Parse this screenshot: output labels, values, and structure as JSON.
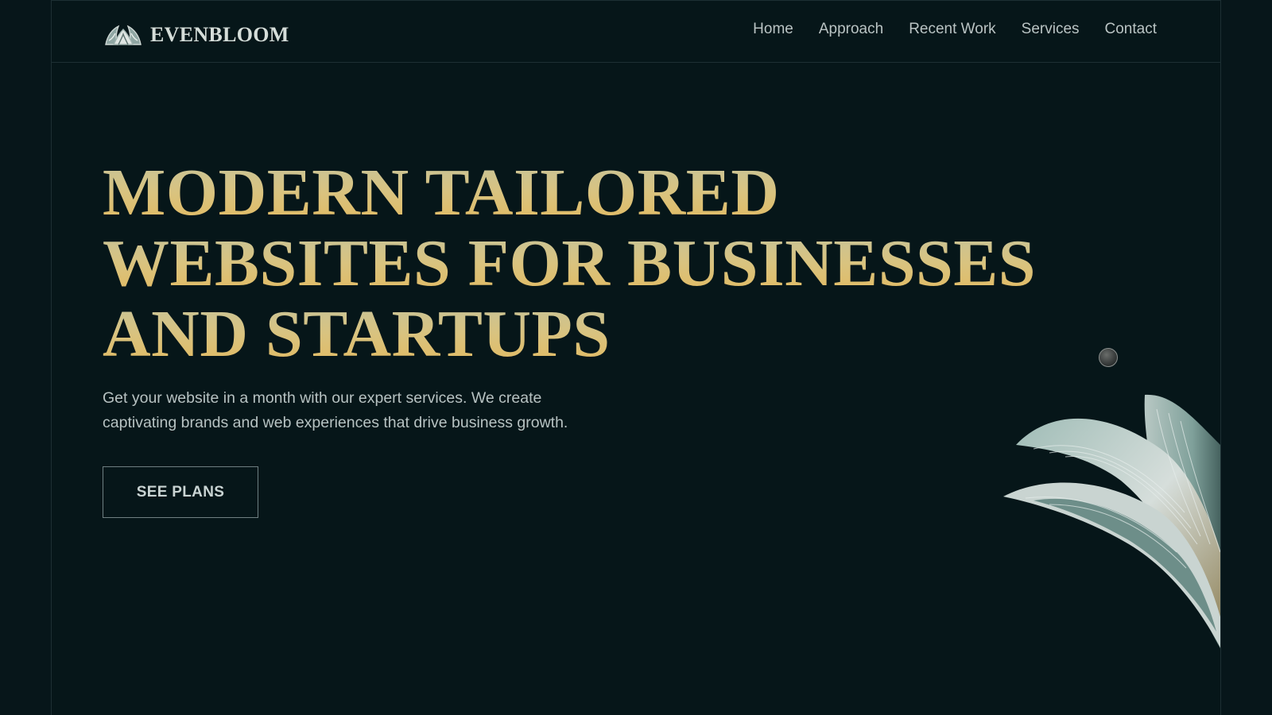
{
  "brand": {
    "name": "EVENBLOOM",
    "logo_icon": "bloom-logo-icon"
  },
  "nav": {
    "items": [
      {
        "label": "Home"
      },
      {
        "label": "Approach"
      },
      {
        "label": "Recent Work"
      },
      {
        "label": "Services"
      },
      {
        "label": "Contact"
      }
    ]
  },
  "hero": {
    "title_lines": [
      "MODERN TAILORED",
      "WEBSITES FOR BUSINESSES",
      "AND STARTUPS"
    ],
    "subtitle": "Get your website in a month with our expert services. We create captivating brands and web experiences that drive business growth.",
    "cta_label": "SEE PLANS"
  },
  "decor": {
    "leaf_icon": "leaf-illustration-icon",
    "dot_icon": "orb-dot-icon"
  },
  "colors": {
    "background": "#061619",
    "title_gradient_top": "#c5c39c",
    "title_gradient_bottom": "#e3b95e",
    "text": "#b7c2c2",
    "border": "#1d2f33"
  }
}
